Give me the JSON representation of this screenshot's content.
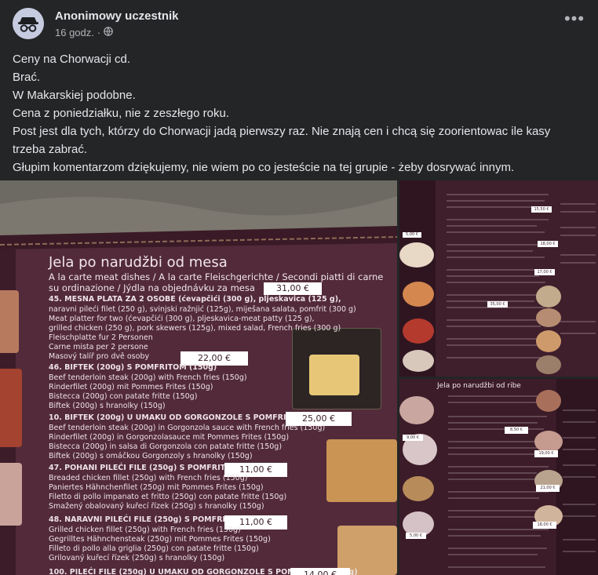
{
  "post": {
    "author": "Anonimowy uczestnik",
    "time": "16 godz.",
    "separator": "·",
    "more_label": "•••",
    "text_lines": [
      "Ceny na Chorwacji cd.",
      "Brać.",
      "W Makarskiej podobne.",
      "Cena z poniedziałku, nie z zeszłego roku.",
      "Post jest dla tych, którzy do Chorwacji jadą pierwszy raz. Nie znają cen i chcą się zoorientowac ile kasy trzeba zabrać.",
      "Głupim komentarzom dziękujemy, nie wiem po co jesteście na tej grupie - żeby dosrywać innym."
    ]
  },
  "menu": {
    "heading": "Jela po narudžbi od mesa",
    "subheading": "A la carte meat dishes / A la carte Fleischgerichte / Secondi piatti di carne",
    "subheading2": "su ordinazione / Jýdla na objednávku za mesa",
    "items": [
      {
        "title": "45. MESNA PLATA ZA 2 OSOBE (ćevapčići (300 g), pljeskavica (125 g),",
        "lines": [
          "naravni pileći filet (250 g), svinjski ražnjić (125g), miješana salata, pomfrit (300 g)",
          "Meat platter for two (ćevapčići (300 g), pljeskavica-meat patty (125 g),",
          "grilled chicken (250 g), pork skewers (125g), mixed salad, French fries (300 g)",
          "Fleischplatte fur 2 Personen",
          "Carne mista per 2 persone",
          "Masový talíř pro dvě osoby"
        ],
        "price": "31,00 €"
      },
      {
        "title": "46. BIFTEK (200g) S POMFRITOM (150g)",
        "lines": [
          "Beef tenderloin steak (200g) with French fries (150g)",
          "Rinderfilet (200g) mit Pommes Frites (150g)",
          "Bistecca (200g) con patate fritte (150g)",
          "Biftek (200g) s hranolky (150g)"
        ],
        "price": "22,00 €"
      },
      {
        "title": "10. BIFTEK (200g) U UMAKU OD GORGONZOLE S POMFRITOM (150g)",
        "lines": [
          "Beef tenderloin steak (200g) in Gorgonzola sauce with French fries (150g)",
          "Rinderfilet (200g) in Gorgonzolasauce mit Pommes Frites (150g)",
          "Bistecca (200g) in salsa di Gorgonzola con patate fritte (150g)",
          "Biftek (200g) s omáčkou Gorgonzoly s hranolky (150g)"
        ],
        "price": "25,00 €"
      },
      {
        "title": "47. POHANI PILEĆI FILE (250g) S POMFRITOM (150g)",
        "lines": [
          "Breaded chicken fillet (250g) with French fries (150g)",
          "Paniertes Hähnchenfilet (250g) mit Pommes Frites (150g)",
          "Filetto di pollo impanato et fritto (250g) con patate fritte (150g)",
          "Smažený obalovaný kuřecí řízek (250g) s hranolky (150g)"
        ],
        "price": "11,00 €"
      },
      {
        "title": "48. NARAVNI PILEĆI FILE (250g) S POMFRITOM (150g)",
        "lines": [
          "Grilled chicken fillet (250g) with French fries (150g)",
          "Gegrilltes Hähnchensteak (250g) mit Pommes Frites (150g)",
          "Filleto di pollo alla griglia (250g) con patate fritte (150g)",
          "Grilovaný kuřecí řízek (250g) s hranolky (150g)"
        ],
        "price": "11,00 €"
      }
    ],
    "last_title": "100. PILEĆI FILE (250g) U UMAKU OD GORGONZOLE S POMFRITOM (150g)",
    "last_price": "14,00 €"
  },
  "side_photo_2": {
    "heading": "Jela po narudžbi od ribe",
    "prices": [
      "9,00 €",
      "8,50 €",
      "21,00 €",
      "19,00 €",
      "5,00 €",
      "18,00 €"
    ]
  },
  "side_photo_1": {
    "prices": [
      "5,00 €",
      "15,50 €",
      "18,00 €",
      "17,00 €",
      "35,00 €"
    ]
  },
  "colors": {
    "background": "#242526",
    "text": "#e4e6eb",
    "muted": "#b0b3b8",
    "menu_board": "#4a2533"
  },
  "icons": {
    "avatar": "incognito-avatar-icon",
    "privacy": "globe-icon",
    "more": "more-horizontal-icon"
  }
}
